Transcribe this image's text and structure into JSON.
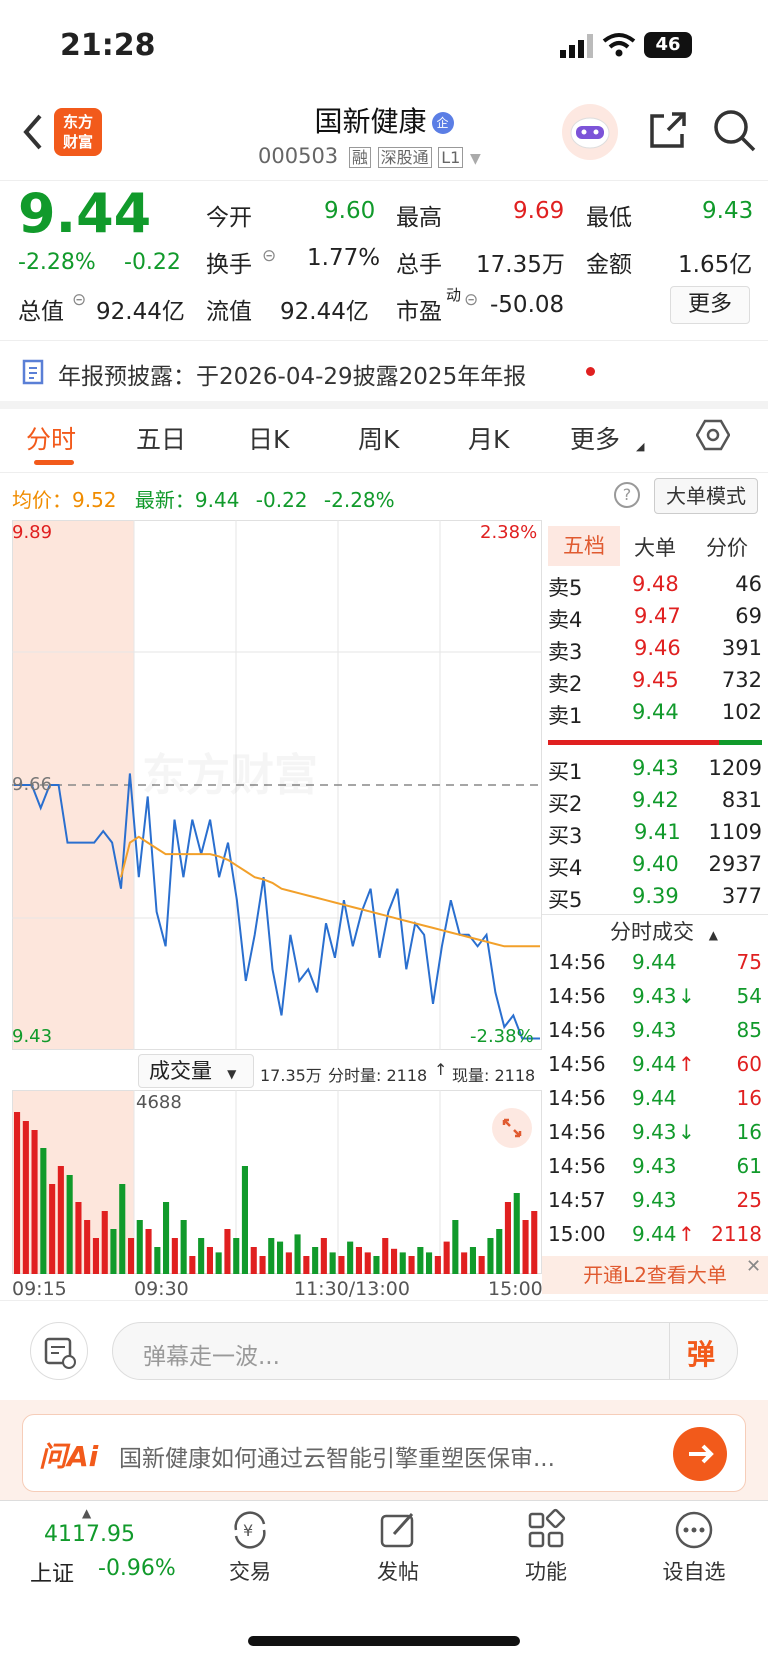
{
  "status": {
    "time": "21:28",
    "battery": "46"
  },
  "header": {
    "title": "国新健康",
    "title_badge": "企",
    "code": "000503",
    "tags": [
      "融",
      "深股通",
      "L1"
    ],
    "brand_logo_text": "东方财富"
  },
  "quote": {
    "price": "9.44",
    "change_pct": "-2.28%",
    "change": "-0.22",
    "stats": [
      {
        "label": "今开",
        "value": "9.60"
      },
      {
        "label": "最高",
        "value": "9.69"
      },
      {
        "label": "最低",
        "value": "9.43"
      },
      {
        "label": "换手",
        "value": "1.77%"
      },
      {
        "label": "总手",
        "value": "17.35万"
      },
      {
        "label": "金额",
        "value": "1.65亿"
      },
      {
        "label": "总值",
        "value": "92.44亿"
      },
      {
        "label": "流值",
        "value": "92.44亿"
      },
      {
        "label": "市盈",
        "label_sup": "动",
        "value": "-50.08"
      }
    ],
    "more_button": "更多"
  },
  "notice": {
    "text": "年报预披露：于2026-04-29披露2025年年报"
  },
  "tabs": [
    "分时",
    "五日",
    "日K",
    "周K",
    "月K",
    "更多"
  ],
  "active_tab": 0,
  "chart_info": {
    "avg_label": "均价：",
    "avg_value": "9.52",
    "latest_label": "最新：",
    "latest_value": "9.44",
    "latest_change": "-0.22",
    "latest_pct": "-2.28%",
    "big_order_mode": "大单模式"
  },
  "chart_data": {
    "type": "line",
    "y_axis_left": {
      "top": "9.89",
      "mid": "9.66",
      "bottom": "9.43"
    },
    "y_axis_right": {
      "top": "2.38%",
      "bottom": "-2.38%"
    },
    "ylim": [
      9.43,
      9.89
    ],
    "prev_close": 9.66,
    "x_ticks": [
      "09:15",
      "09:30",
      "11:30/13:00",
      "15:00"
    ],
    "series": [
      {
        "color": "#2a6fcf",
        "values": [
          9.66,
          9.66,
          9.66,
          9.64,
          9.66,
          9.66,
          9.61,
          9.61,
          9.61,
          9.61,
          9.62,
          9.61,
          9.57,
          9.67,
          9.58,
          9.65,
          9.55,
          9.52,
          9.63,
          9.58,
          9.63,
          9.6,
          9.63,
          9.58,
          9.61,
          9.56,
          9.49,
          9.53,
          9.58,
          9.5,
          9.46,
          9.53,
          9.49,
          9.5,
          9.48,
          9.54,
          9.51,
          9.56,
          9.52,
          9.55,
          9.57,
          9.51,
          9.55,
          9.57,
          9.5,
          9.54,
          9.53,
          9.47,
          9.52,
          9.56,
          9.53,
          9.53,
          9.52,
          9.53,
          9.48,
          9.45,
          9.46,
          9.44,
          9.44,
          9.44
        ]
      },
      {
        "color": "#f2a02a",
        "values": [
          null,
          null,
          null,
          null,
          null,
          null,
          null,
          null,
          null,
          null,
          null,
          null,
          9.58,
          9.61,
          9.615,
          9.61,
          9.605,
          9.6,
          9.6,
          9.6,
          9.6,
          9.6,
          9.6,
          9.598,
          9.595,
          9.59,
          9.585,
          9.58,
          9.578,
          9.575,
          9.57,
          9.568,
          9.566,
          9.564,
          9.562,
          9.56,
          9.558,
          9.556,
          9.554,
          9.552,
          9.55,
          9.548,
          9.546,
          9.544,
          9.542,
          9.54,
          9.538,
          9.536,
          9.534,
          9.532,
          9.53,
          9.528,
          9.526,
          9.524,
          9.522,
          9.52,
          9.52,
          9.52,
          9.52,
          9.52
        ]
      }
    ],
    "volume": {
      "label": "成交量",
      "total": "17.35万",
      "per_minute": "分时量: 2118",
      "current": "现量: 2118",
      "max_label": "4688",
      "bars": [
        0.9,
        0.85,
        0.8,
        0.7,
        0.5,
        0.6,
        0.55,
        0.4,
        0.3,
        0.2,
        0.35,
        0.25,
        0.5,
        0.2,
        0.3,
        0.25,
        0.15,
        0.4,
        0.2,
        0.3,
        0.1,
        0.2,
        0.15,
        0.12,
        0.25,
        0.2,
        0.6,
        0.15,
        0.1,
        0.2,
        0.18,
        0.12,
        0.22,
        0.1,
        0.15,
        0.2,
        0.12,
        0.1,
        0.18,
        0.15,
        0.12,
        0.1,
        0.2,
        0.14,
        0.12,
        0.1,
        0.15,
        0.12,
        0.1,
        0.18,
        0.3,
        0.12,
        0.15,
        0.1,
        0.2,
        0.25,
        0.4,
        0.45,
        0.3,
        0.35
      ]
    }
  },
  "order_book": {
    "tabs": [
      "五档",
      "大单",
      "分价"
    ],
    "asks": [
      {
        "label": "卖5",
        "price": "9.48",
        "vol": "46"
      },
      {
        "label": "卖4",
        "price": "9.47",
        "vol": "69"
      },
      {
        "label": "卖3",
        "price": "9.46",
        "vol": "391"
      },
      {
        "label": "卖2",
        "price": "9.45",
        "vol": "732"
      },
      {
        "label": "卖1",
        "price": "9.44",
        "vol": "102"
      }
    ],
    "bids": [
      {
        "label": "买1",
        "price": "9.43",
        "vol": "1209"
      },
      {
        "label": "买2",
        "price": "9.42",
        "vol": "831"
      },
      {
        "label": "买3",
        "price": "9.41",
        "vol": "1109"
      },
      {
        "label": "买4",
        "price": "9.40",
        "vol": "2937"
      },
      {
        "label": "买5",
        "price": "9.39",
        "vol": "377"
      }
    ]
  },
  "trades": {
    "title": "分时成交",
    "rows": [
      {
        "time": "14:56",
        "price": "9.44",
        "arrow": "",
        "vol": "75"
      },
      {
        "time": "14:56",
        "price": "9.43",
        "arrow": "↓",
        "vol": "54"
      },
      {
        "time": "14:56",
        "price": "9.43",
        "arrow": "",
        "vol": "85"
      },
      {
        "time": "14:56",
        "price": "9.44",
        "arrow": "↑",
        "vol": "60"
      },
      {
        "time": "14:56",
        "price": "9.44",
        "arrow": "",
        "vol": "16"
      },
      {
        "time": "14:56",
        "price": "9.43",
        "arrow": "↓",
        "vol": "16"
      },
      {
        "time": "14:56",
        "price": "9.43",
        "arrow": "",
        "vol": "61"
      },
      {
        "time": "14:57",
        "price": "9.43",
        "arrow": "",
        "vol": "25"
      },
      {
        "time": "15:00",
        "price": "9.44",
        "arrow": "↑",
        "vol": "2118"
      }
    ],
    "l2_banner": "开通L2查看大单"
  },
  "danmu": {
    "placeholder": "弹幕走一波...",
    "button": "弹"
  },
  "ai_bar": {
    "logo": "问Ai",
    "text": "国新健康如何通过云智能引擎重塑医保审..."
  },
  "bottom_nav": {
    "index_value": "4117.95",
    "index_name": "上证",
    "index_change": "-0.96%",
    "items": [
      "交易",
      "发帖",
      "功能",
      "设自选"
    ]
  }
}
